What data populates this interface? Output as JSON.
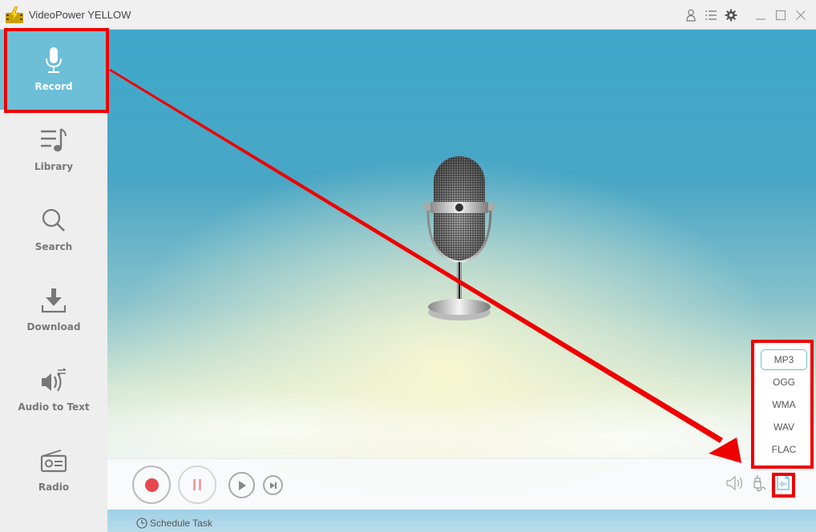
{
  "app": {
    "title": "VideoPower YELLOW"
  },
  "titlebar": {
    "icons": [
      "user-icon",
      "list-menu-icon",
      "gear-icon",
      "minimize-icon",
      "maximize-icon",
      "close-icon"
    ]
  },
  "sidebar": {
    "items": [
      {
        "label": "Record",
        "icon": "microphone-icon",
        "active": true
      },
      {
        "label": "Library",
        "icon": "music-library-icon",
        "active": false
      },
      {
        "label": "Search",
        "icon": "search-icon",
        "active": false
      },
      {
        "label": "Download",
        "icon": "download-icon",
        "active": false
      },
      {
        "label": "Audio to Text",
        "icon": "audio-to-text-icon",
        "active": false
      },
      {
        "label": "Radio",
        "icon": "radio-icon",
        "active": false
      }
    ]
  },
  "controls": {
    "record_icon": "record-icon",
    "pause_icon": "pause-icon",
    "play_icon": "play-icon",
    "skip_icon": "skip-next-icon",
    "schedule_label": "Schedule Task"
  },
  "format_menu": {
    "selected": "MP3",
    "options": [
      "MP3",
      "OGG",
      "WMA",
      "WAV",
      "FLAC"
    ]
  },
  "colors": {
    "accent": "#6cbfd6",
    "record_red": "#e8474f",
    "annotation_red": "#ee0000"
  }
}
